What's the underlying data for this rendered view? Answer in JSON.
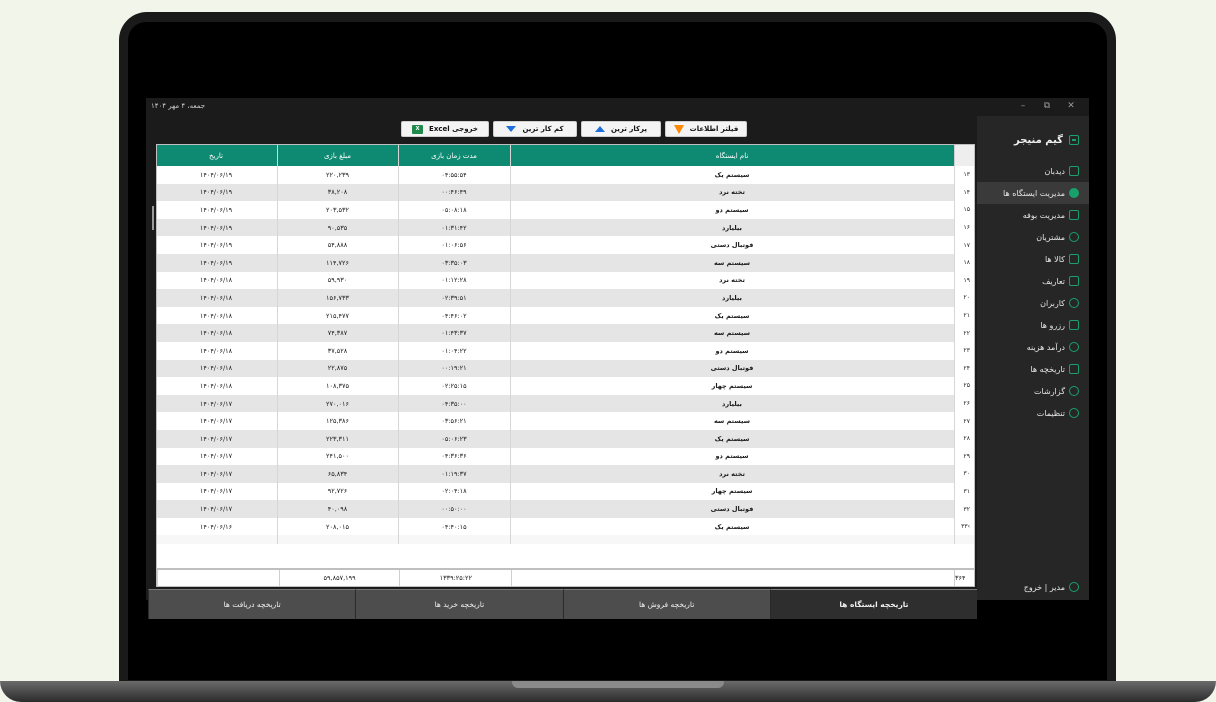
{
  "window": {
    "date": "جمعه، ۴ مهر ۱۴۰۴",
    "minimize": "–",
    "maximize": "⧉",
    "close": "✕"
  },
  "sidebar": {
    "app_title": "گیم منیجر",
    "items": [
      {
        "label": "دیدبان",
        "icon": "monitor-icon"
      },
      {
        "label": "مدیریت ایستگاه ها",
        "icon": "pie-icon",
        "active": true
      },
      {
        "label": "مدیریت بوفه",
        "icon": "card-icon"
      },
      {
        "label": "مشتریان",
        "icon": "users-icon"
      },
      {
        "label": "کالا ها",
        "icon": "box-icon"
      },
      {
        "label": "تعاریف",
        "icon": "grid-icon"
      },
      {
        "label": "کاربران",
        "icon": "user-icon"
      },
      {
        "label": "رزرو ها",
        "icon": "ticket-icon"
      },
      {
        "label": "درآمد هزینه",
        "icon": "money-bag-icon"
      },
      {
        "label": "تاریخچه ها",
        "icon": "list-icon"
      },
      {
        "label": "گزارشات",
        "icon": "chart-icon"
      },
      {
        "label": "تنظیمات",
        "icon": "gear-icon"
      }
    ],
    "logout": "مدیر | خروج"
  },
  "toolbar": {
    "excel": "خروجی Excel",
    "least_played": "کم کار ترین",
    "most_played": "پرکار ترین",
    "filter": "فیلتر اطلاعات",
    "excel_icon_text": "X"
  },
  "table": {
    "columns": [
      "نام ایستگاه",
      "مدت زمان بازی",
      "مبلغ بازی",
      "تاریخ"
    ],
    "rows": [
      {
        "num": "۱۳",
        "name": "سیستم یک",
        "duration": "۰۴:۵۵:۵۴",
        "amount": "۲۲۰,۲۳۹",
        "date": "۱۴۰۴/۰۶/۱۹"
      },
      {
        "num": "۱۴",
        "name": "تخته نرد",
        "duration": "۰۰:۴۶:۴۹",
        "amount": "۳۸,۲۰۸",
        "date": "۱۴۰۴/۰۶/۱۹"
      },
      {
        "num": "۱۵",
        "name": "سیستم دو",
        "duration": "۰۵:۰۸:۱۸",
        "amount": "۲۰۳,۵۳۲",
        "date": "۱۴۰۴/۰۶/۱۹"
      },
      {
        "num": "۱۶",
        "name": "بیلیارد",
        "duration": "۰۱:۳۱:۴۲",
        "amount": "۹۰,۵۳۵",
        "date": "۱۴۰۴/۰۶/۱۹"
      },
      {
        "num": "۱۷",
        "name": "فوتبال دستی",
        "duration": "۰۱:۰۶:۵۶",
        "amount": "۵۴,۸۸۸",
        "date": "۱۴۰۴/۰۶/۱۹"
      },
      {
        "num": "۱۸",
        "name": "سیستم سه",
        "duration": "۰۳:۳۵:۰۳",
        "amount": "۱۱۴,۷۲۶",
        "date": "۱۴۰۴/۰۶/۱۹"
      },
      {
        "num": "۱۹",
        "name": "تخته نرد",
        "duration": "۰۱:۱۲:۲۸",
        "amount": "۵۹,۹۳۰",
        "date": "۱۴۰۴/۰۶/۱۸"
      },
      {
        "num": "۲۰",
        "name": "بیلیارد",
        "duration": "۰۲:۳۹:۵۱",
        "amount": "۱۵۶,۷۳۳",
        "date": "۱۴۰۴/۰۶/۱۸"
      },
      {
        "num": "۲۱",
        "name": "سیستم یک",
        "duration": "۰۴:۴۶:۰۲",
        "amount": "۲۱۵,۴۷۷",
        "date": "۱۴۰۴/۰۶/۱۸"
      },
      {
        "num": "۲۲",
        "name": "سیستم سه",
        "duration": "۰۱:۴۳:۳۷",
        "amount": "۷۴,۳۸۷",
        "date": "۱۴۰۴/۰۶/۱۸"
      },
      {
        "num": "۲۳",
        "name": "سیستم دو",
        "duration": "۰۱:۰۴:۲۲",
        "amount": "۳۷,۵۲۸",
        "date": "۱۴۰۴/۰۶/۱۸"
      },
      {
        "num": "۲۴",
        "name": "فوتبال دستی",
        "duration": "۰۰:۱۹:۲۱",
        "amount": "۲۲,۸۷۵",
        "date": "۱۴۰۴/۰۶/۱۸"
      },
      {
        "num": "۲۵",
        "name": "سیستم چهار",
        "duration": "۰۲:۲۵:۱۵",
        "amount": "۱۰۸,۳۷۵",
        "date": "۱۴۰۴/۰۶/۱۸"
      },
      {
        "num": "۲۶",
        "name": "بیلیارد",
        "duration": "۰۴:۳۵:۰۰",
        "amount": "۲۷۰,۰۱۶",
        "date": "۱۴۰۴/۰۶/۱۷"
      },
      {
        "num": "۲۷",
        "name": "سیستم سه",
        "duration": "۰۳:۵۶:۲۱",
        "amount": "۱۲۵,۳۸۶",
        "date": "۱۴۰۴/۰۶/۱۷"
      },
      {
        "num": "۲۸",
        "name": "سیستم یک",
        "duration": "۰۵:۰۶:۲۳",
        "amount": "۲۲۳,۳۱۱",
        "date": "۱۴۰۴/۰۶/۱۷"
      },
      {
        "num": "۲۹",
        "name": "سیستم دو",
        "duration": "۰۴:۳۶:۳۶",
        "amount": "۲۴۱,۵۰۰",
        "date": "۱۴۰۴/۰۶/۱۷"
      },
      {
        "num": "۳۰",
        "name": "تخته نرد",
        "duration": "۰۱:۱۹:۳۷",
        "amount": "۶۵,۸۳۴",
        "date": "۱۴۰۴/۰۶/۱۷"
      },
      {
        "num": "۳۱",
        "name": "سیستم چهار",
        "duration": "۰۲:۰۴:۱۸",
        "amount": "۹۲,۷۲۶",
        "date": "۱۴۰۴/۰۶/۱۷"
      },
      {
        "num": "۳۲",
        "name": "فوتبال دستی",
        "duration": "۰۰:۵۰:۰۰",
        "amount": "۴۰,۰۹۸",
        "date": "۱۴۰۴/۰۶/۱۷"
      },
      {
        "num": "۳۳",
        "name": "سیستم یک",
        "duration": "۰۴:۴۰:۱۵",
        "amount": "۲۰۸,۰۱۵",
        "date": "۱۴۰۴/۰۶/۱۶"
      }
    ],
    "current_row_marker": "›"
  },
  "summary": {
    "count": "۳۶۴",
    "total_duration": "۱۳۳۹:۲۵:۲۲",
    "total_amount": "۵۹,۸۵۷,۱۹۹"
  },
  "tabs": [
    {
      "label": "تاریخچه ایستگاه ها",
      "active": true
    },
    {
      "label": "تاریخچه فروش ها"
    },
    {
      "label": "تاریخچه خرید ها"
    },
    {
      "label": "تاریخچه دریافت ها"
    }
  ],
  "colors": {
    "accent": "#0e8a72",
    "sidebar_icon": "#19a06c",
    "funnel": "#ff8a00",
    "sort_arrow": "#1e6fd9"
  }
}
